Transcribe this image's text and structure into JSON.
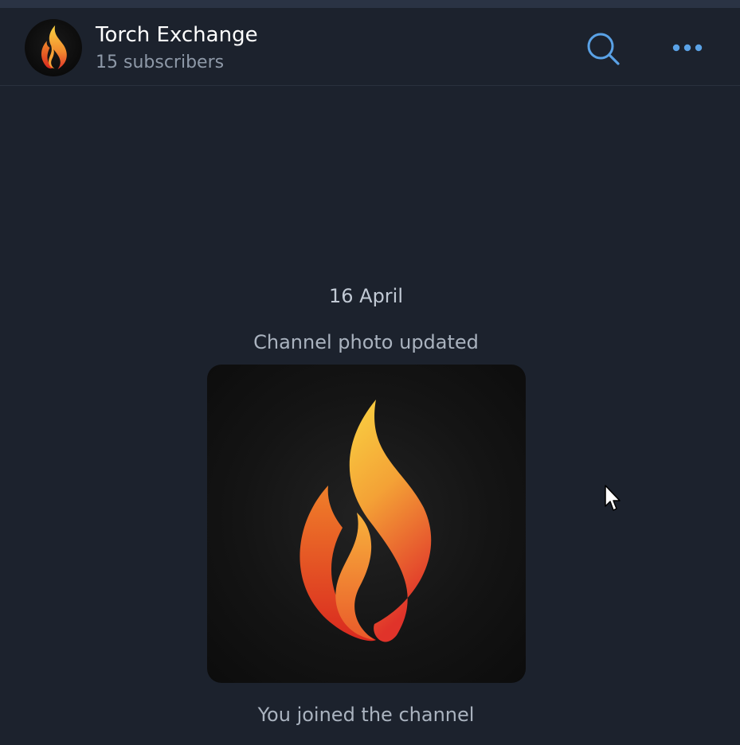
{
  "channel": {
    "name": "Torch Exchange",
    "subscribers": "15 subscribers"
  },
  "header": {
    "search_icon": "search-icon",
    "more_icon": "more-horizontal-icon"
  },
  "messages": {
    "date": "16 April",
    "photo_updated": "Channel photo updated",
    "joined": "You joined the channel"
  },
  "colors": {
    "background": "#1c222d",
    "accent": "#5aa2e6",
    "flame_yellow": "#f7c93b",
    "flame_orange": "#f28a2e",
    "flame_red": "#e0332a"
  }
}
